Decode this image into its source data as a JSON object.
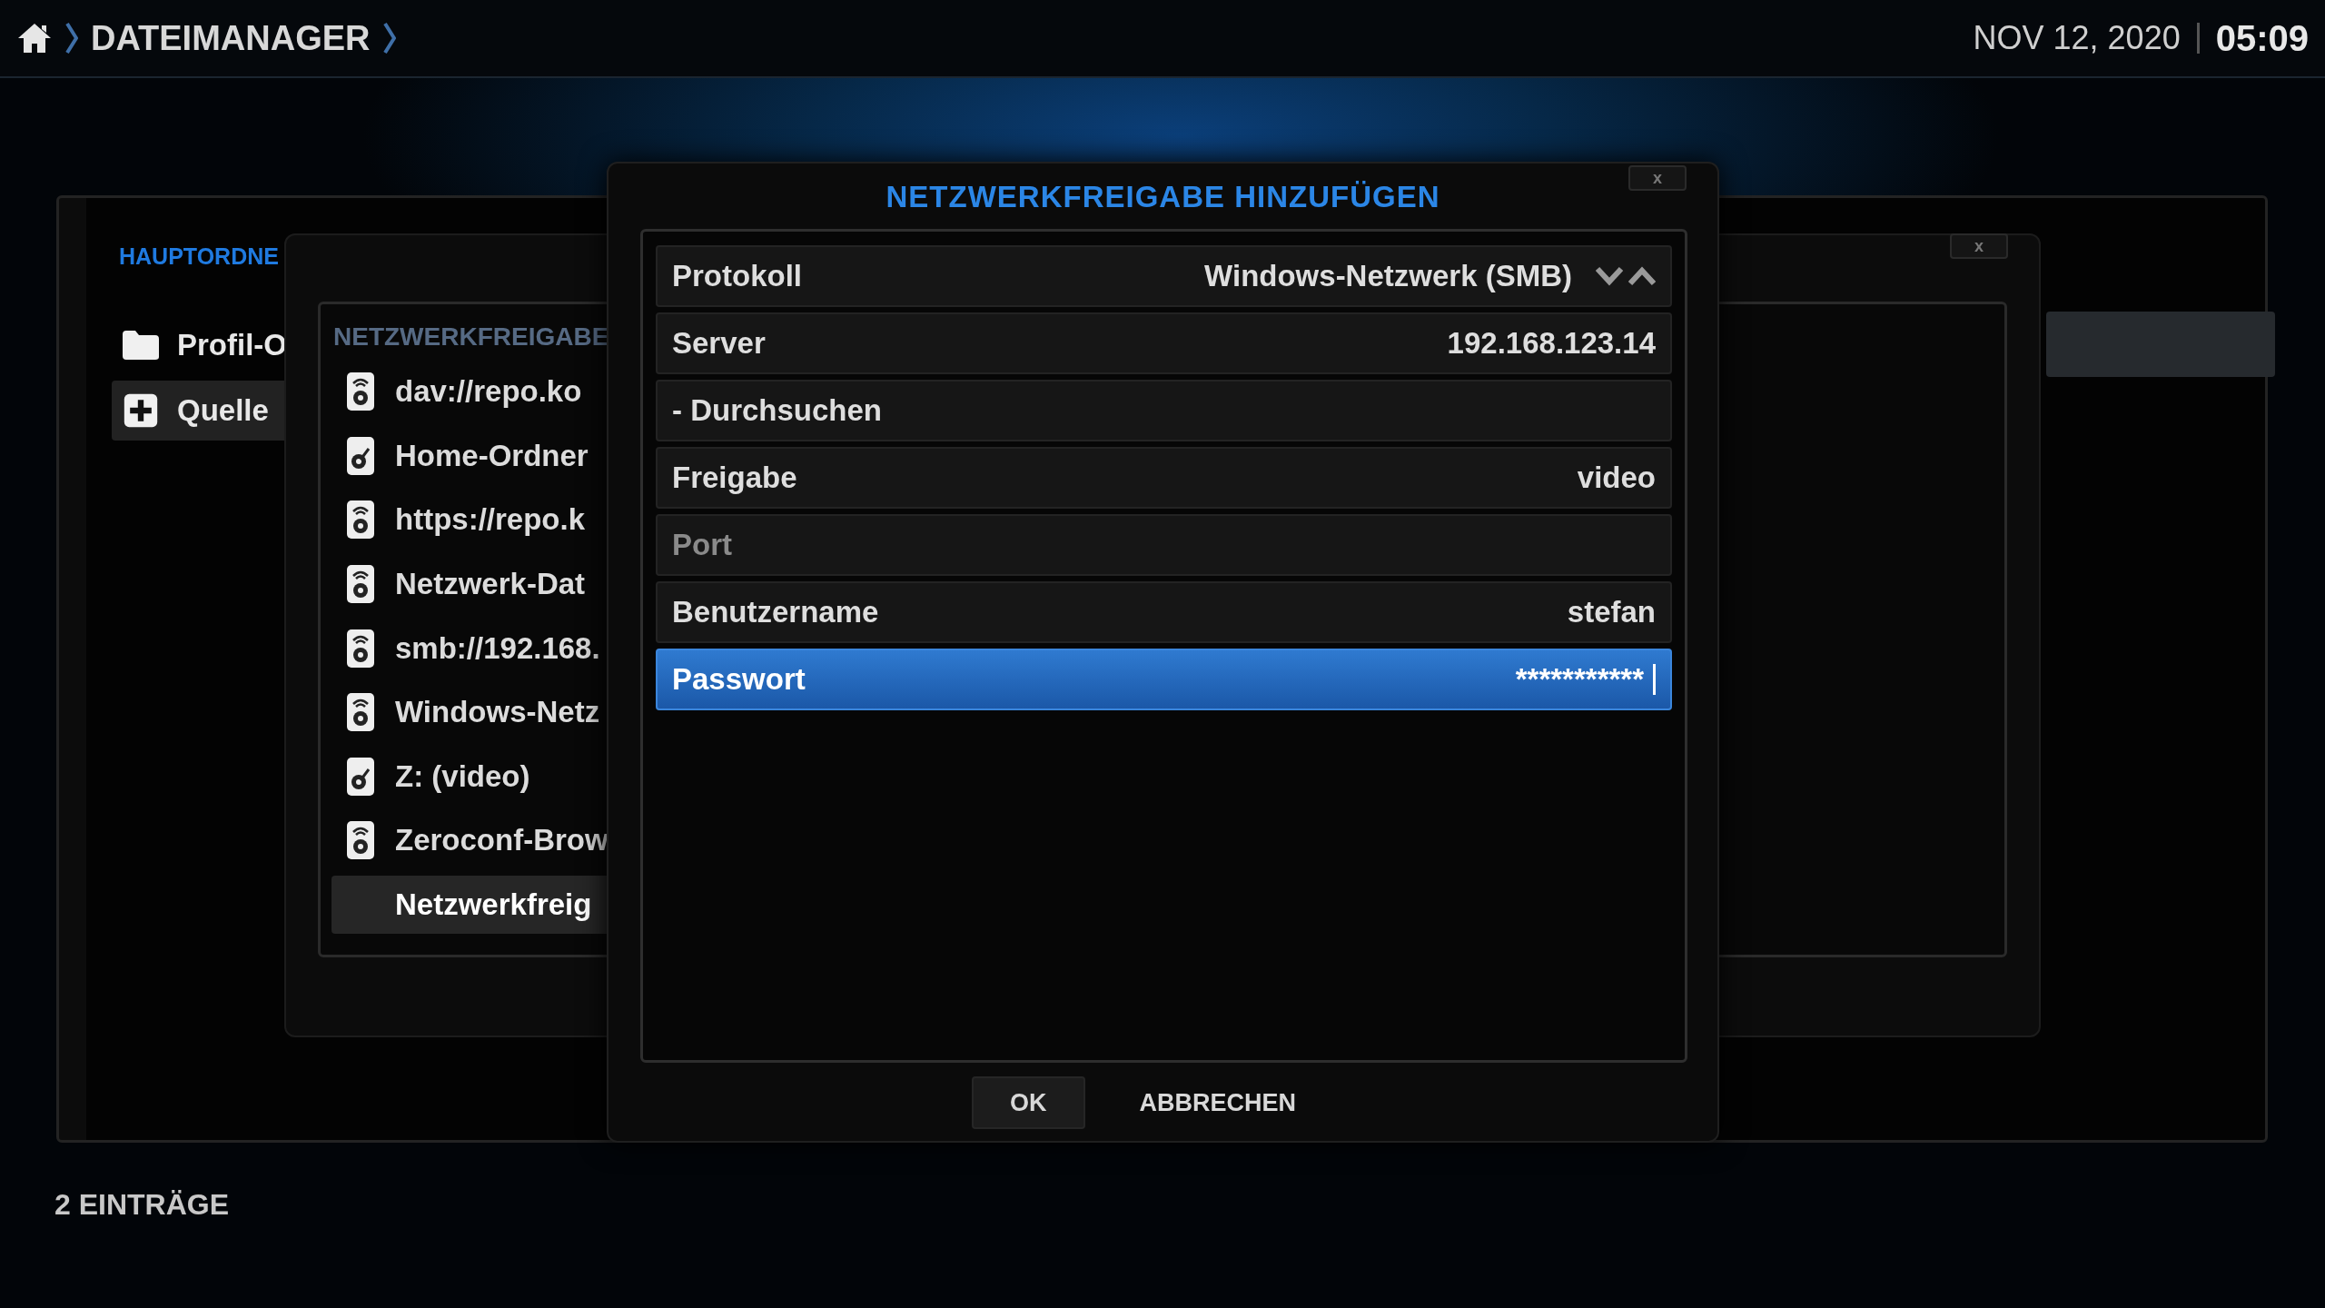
{
  "top_bar": {
    "breadcrumb": "DATEIMANAGER",
    "date": "NOV 12, 2020",
    "time": "05:09"
  },
  "main": {
    "heading": "HAUPTORDNE",
    "items": [
      {
        "label": "Profil-O",
        "kind": "folder",
        "selected": false
      },
      {
        "label": "Quelle",
        "kind": "add",
        "selected": true
      }
    ],
    "footer": "2 EINTRÄGE"
  },
  "browse_dialog": {
    "title": "NETZWERKFREIGABE",
    "close": "x",
    "items": [
      {
        "label": "dav://repo.ko",
        "kind": "network",
        "selected": false
      },
      {
        "label": "Home-Ordner",
        "kind": "local",
        "selected": false
      },
      {
        "label": "https://repo.k",
        "kind": "network",
        "selected": false
      },
      {
        "label": "Netzwerk-Dat",
        "kind": "network",
        "selected": false
      },
      {
        "label": "smb://192.168.",
        "kind": "network",
        "selected": false
      },
      {
        "label": "Windows-Netz",
        "kind": "network",
        "selected": false
      },
      {
        "label": "Z: (video)",
        "kind": "local",
        "selected": false
      },
      {
        "label": "Zeroconf-Brow",
        "kind": "network",
        "selected": false
      },
      {
        "label": "Netzwerkfreig",
        "kind": "action",
        "selected": true
      }
    ]
  },
  "dialog": {
    "title": "NETZWERKFREIGABE HINZUFÜGEN",
    "close": "x",
    "rows": [
      {
        "label": "Protokoll",
        "value": "Windows-Netzwerk (SMB)",
        "kind": "spinner",
        "disabled": false,
        "selected": false
      },
      {
        "label": "Server",
        "value": "192.168.123.14",
        "kind": "text",
        "disabled": false,
        "selected": false
      },
      {
        "label": "- Durchsuchen",
        "kind": "button",
        "disabled": false,
        "selected": false
      },
      {
        "label": "Freigabe",
        "value": "video",
        "kind": "text",
        "disabled": false,
        "selected": false
      },
      {
        "label": "Port",
        "kind": "text",
        "disabled": true,
        "selected": false
      },
      {
        "label": "Benutzername",
        "value": "stefan",
        "kind": "text",
        "disabled": false,
        "selected": false
      },
      {
        "label": "Passwort",
        "value": "***********",
        "kind": "password",
        "disabled": false,
        "selected": true
      }
    ],
    "buttons": [
      {
        "label": "OK",
        "selected": true
      },
      {
        "label": "ABBRECHEN",
        "selected": false
      }
    ]
  }
}
